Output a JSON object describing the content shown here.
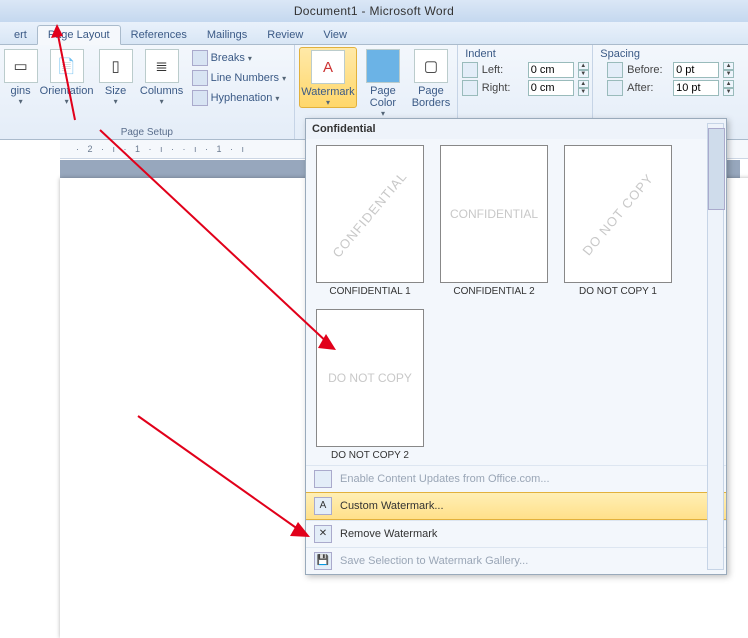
{
  "window_title": "Document1 - Microsoft Word",
  "tabs": {
    "t0": "ert",
    "t1": "Page Layout",
    "t2": "References",
    "t3": "Mailings",
    "t4": "Review",
    "t5": "View"
  },
  "btn": {
    "margins": "gins",
    "orientation": "Orientation",
    "size": "Size",
    "columns": "Columns",
    "breaks": "Breaks",
    "linenumbers": "Line Numbers",
    "hyphenation": "Hyphenation",
    "watermark": "Watermark",
    "pagecolor": "Page Color",
    "pageborders": "Page Borders"
  },
  "group": {
    "pagesetup": "Page Setup"
  },
  "indent": {
    "title": "Indent",
    "left_label": "Left:",
    "left_value": "0 cm",
    "right_label": "Right:",
    "right_value": "0 cm"
  },
  "spacing": {
    "title": "Spacing",
    "before_label": "Before:",
    "before_value": "0 pt",
    "after_label": "After:",
    "after_value": "10 pt"
  },
  "gallery": {
    "heading": "Confidential",
    "items": [
      {
        "wm": "CONFIDENTIAL",
        "cap": "CONFIDENTIAL 1",
        "diag": true
      },
      {
        "wm": "CONFIDENTIAL",
        "cap": "CONFIDENTIAL 2",
        "diag": false
      },
      {
        "wm": "DO NOT COPY",
        "cap": "DO NOT COPY 1",
        "diag": true
      },
      {
        "wm": "DO NOT COPY",
        "cap": "DO NOT COPY 2",
        "diag": false
      }
    ],
    "menu_enable": "Enable Content Updates from Office.com...",
    "menu_custom": "Custom Watermark...",
    "menu_remove": "Remove Watermark",
    "menu_save": "Save Selection to Watermark Gallery..."
  },
  "ruler_text": "· 2 · ı · 1 · ı ·   · ı · 1 · ı"
}
